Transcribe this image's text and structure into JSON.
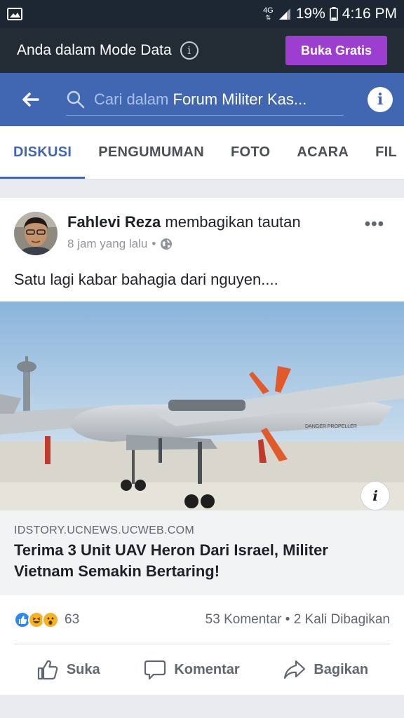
{
  "status_bar": {
    "network": "4G",
    "battery": "19%",
    "time": "4:16 PM",
    "icons": [
      "gallery-icon",
      "signal-icon",
      "battery-icon"
    ]
  },
  "data_mode": {
    "text": "Anda dalam Mode Data",
    "info_icon": "i",
    "button_label": "Buka Gratis",
    "button_color": "#9c3fd1"
  },
  "search": {
    "prefix": "Cari dalam",
    "group_name": "Forum Militer Kas...",
    "info_icon": "i"
  },
  "tabs": [
    {
      "label": "DISKUSI",
      "active": true
    },
    {
      "label": "PENGUMUMAN",
      "active": false
    },
    {
      "label": "FOTO",
      "active": false
    },
    {
      "label": "ACARA",
      "active": false
    },
    {
      "label": "FIL",
      "active": false
    }
  ],
  "post": {
    "author": "Fahlevi Reza",
    "action": "membagikan tautan",
    "time": "8 jam yang lalu",
    "separator": "•",
    "more_icon": "•••",
    "text": "Satu lagi kabar bahagia dari nguyen....",
    "link": {
      "domain": "IDSTORY.UCNEWS.UCWEB.COM",
      "title": "Terima 3 Unit UAV Heron Dari Israel, Militer Vietnam Semakin Bertaring!",
      "image_info_icon": "i",
      "image_caption_marking": "DANGER PROPELLER"
    },
    "reaction_count": "63",
    "comments": "53 Komentar",
    "stat_separator": "•",
    "shares": "2 Kali Dibagikan",
    "actions": {
      "like": "Suka",
      "comment": "Komentar",
      "share": "Bagikan"
    }
  },
  "colors": {
    "facebook_blue": "#4267b2",
    "like_blue": "#2d88ff",
    "haha_yellow": "#f7b125"
  }
}
